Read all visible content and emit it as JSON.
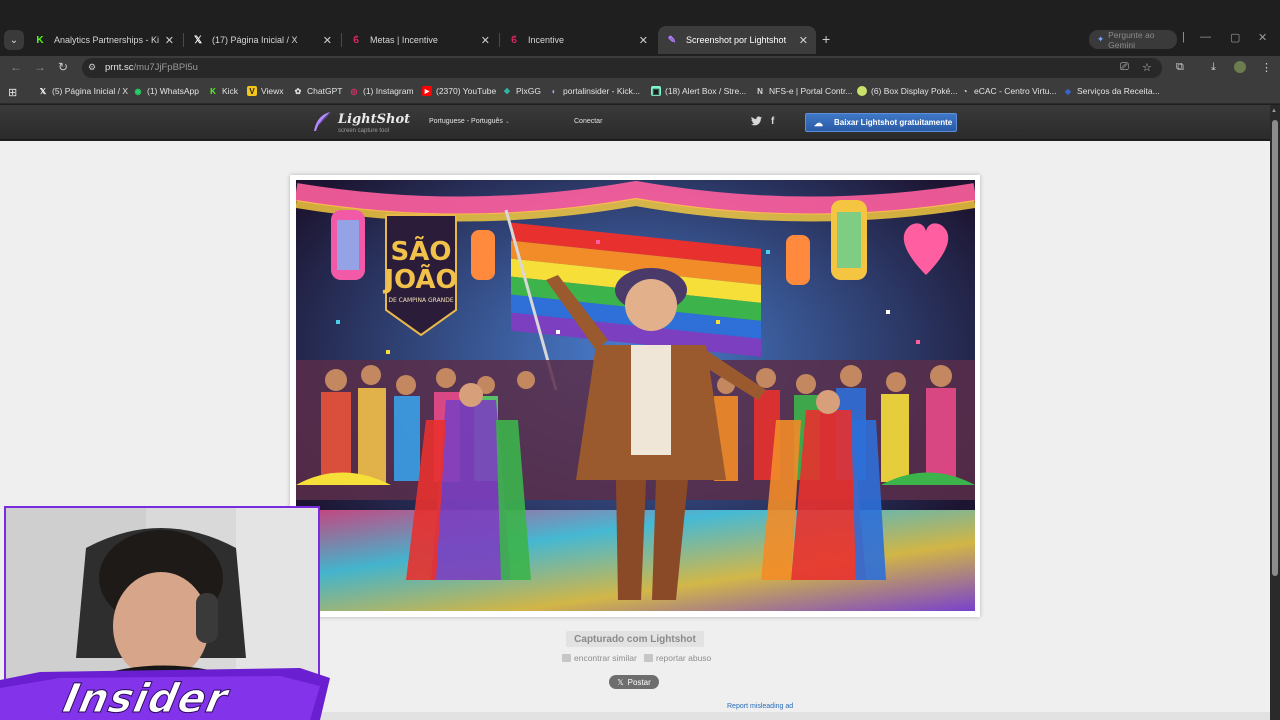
{
  "browser": {
    "tabs": [
      {
        "title": "Analytics Partnerships - Kick Da",
        "favicon": "kick-icon",
        "color": "#53fc18",
        "active": false
      },
      {
        "title": "(17) Página Inicial / X",
        "favicon": "x-icon",
        "color": "#ffffff",
        "active": false
      },
      {
        "title": "Metas | Incentive",
        "favicon": "incentive-icon",
        "color": "#e0245e",
        "active": false
      },
      {
        "title": "Incentive",
        "favicon": "incentive-icon",
        "color": "#e0245e",
        "active": false
      },
      {
        "title": "Screenshot por Lightshot",
        "favicon": "lightshot-icon",
        "color": "#b07cff",
        "active": true
      }
    ],
    "gemini_label": "Pergunte ao Gemini",
    "url_host": "prnt.sc",
    "url_path": "/mu7JjFpBPl5u",
    "bookmarks": [
      {
        "label": "(5) Página Inicial / X",
        "icon": "x-icon",
        "color": "#ffffff"
      },
      {
        "label": "(1) WhatsApp",
        "icon": "whatsapp-icon",
        "color": "#25d366"
      },
      {
        "label": "Kick",
        "icon": "kick-icon",
        "color": "#53fc18"
      },
      {
        "label": "Viewx",
        "icon": "viewx-icon",
        "color": "#f5c518"
      },
      {
        "label": "ChatGPT",
        "icon": "chatgpt-icon",
        "color": "#e0e0e0"
      },
      {
        "label": "(1) Instagram",
        "icon": "instagram-icon",
        "color": "#e1306c"
      },
      {
        "label": "(2370) YouTube",
        "icon": "youtube-icon",
        "color": "#ff0000"
      },
      {
        "label": "PixGG",
        "icon": "pixgg-icon",
        "color": "#32bcad"
      },
      {
        "label": "portalinsider - Kick...",
        "icon": "portal-icon",
        "color": "#9aa7ff"
      },
      {
        "label": "(18) Alert Box / Stre...",
        "icon": "streamlabs-icon",
        "color": "#80f5d2"
      },
      {
        "label": "NFS-e | Portal Contr...",
        "icon": "nfse-icon",
        "color": "#d9d9d9"
      },
      {
        "label": "(6) Box Display Poké...",
        "icon": "pokemon-icon",
        "color": "#c9e26a"
      },
      {
        "label": "eCAC - Centro Virtu...",
        "icon": "ecac-icon",
        "color": "#e6e6e6"
      },
      {
        "label": "Serviços da Receita...",
        "icon": "receita-icon",
        "color": "#1f4ba8"
      }
    ]
  },
  "lightshot": {
    "brand": "LightShot",
    "tagline": "screen capture tool",
    "language": "Portuguese - Português",
    "login": "Conectar",
    "download_label": "Baixar Lightshot gratuitamente",
    "captured_label": "Capturado com Lightshot",
    "find_similar": "encontrar similar",
    "report_abuse": "reportar abuso",
    "post_label": "Postar",
    "report_ad": "Report misleading ad"
  },
  "screenshot_image": {
    "banner_line1": "SÃO",
    "banner_line2": "JOÃO",
    "banner_line3": "DE CAMPINA GRANDE"
  },
  "stream_overlay": {
    "logo_text": "Insider",
    "accent": "#7a2be0"
  }
}
